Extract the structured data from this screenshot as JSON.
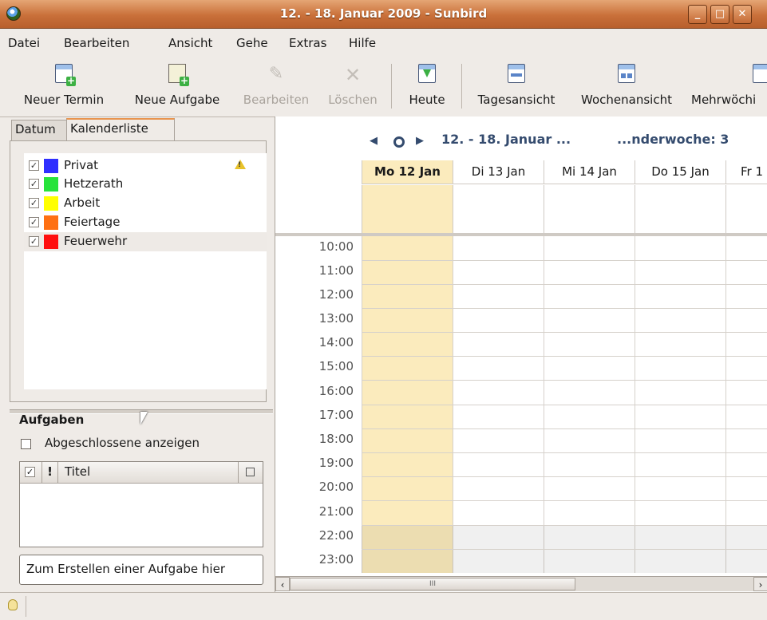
{
  "window": {
    "title": "12. - 18. Januar 2009 - Sunbird"
  },
  "menu": [
    "Datei",
    "Bearbeiten",
    "Ansicht",
    "Gehe",
    "Extras",
    "Hilfe"
  ],
  "toolbar": {
    "new_event": "Neuer Termin",
    "new_task": "Neue Aufgabe",
    "edit": "Bearbeiten",
    "delete": "Löschen",
    "today": "Heute",
    "day_view": "Tagesansicht",
    "week_view": "Wochenansicht",
    "multiweek_view": "Mehrwöchi"
  },
  "left": {
    "tab_date": "Datum",
    "tab_calendar_list": "Kalenderliste",
    "calendars": [
      {
        "name": "Privat",
        "color": "#2f2fff",
        "checked": true
      },
      {
        "name": "Hetzerath",
        "color": "#27e33b",
        "checked": true
      },
      {
        "name": "Arbeit",
        "color": "#ffff00",
        "checked": true
      },
      {
        "name": "Feiertage",
        "color": "#ff7012",
        "checked": true
      },
      {
        "name": "Feuerwehr",
        "color": "#ff0f0f",
        "checked": true
      }
    ],
    "tasks_heading": "Aufgaben",
    "show_completed": "Abgeschlossene anzeigen",
    "task_col_title": "Titel",
    "task_col_priority": "!",
    "create_task_placeholder": "Zum Erstellen einer Aufgabe hier"
  },
  "week": {
    "title_left": "12. - 18. Januar ...",
    "title_right": "...nderwoche: 3",
    "days": [
      "Mo 12 Jan",
      "Di 13 Jan",
      "Mi 14 Jan",
      "Do 15 Jan",
      "Fr 1"
    ],
    "hours": [
      "10:00",
      "11:00",
      "12:00",
      "13:00",
      "14:00",
      "15:00",
      "16:00",
      "17:00",
      "18:00",
      "19:00",
      "20:00",
      "21:00",
      "22:00",
      "23:00"
    ]
  },
  "scrollbar": {
    "left_arrow": "‹",
    "right_arrow": "›",
    "grip": "III"
  },
  "colors": {
    "titlebar": "#c9703a",
    "today_highlight": "#fbebbd",
    "nav_text": "#344b6e",
    "tab_accent": "#e8944f"
  }
}
